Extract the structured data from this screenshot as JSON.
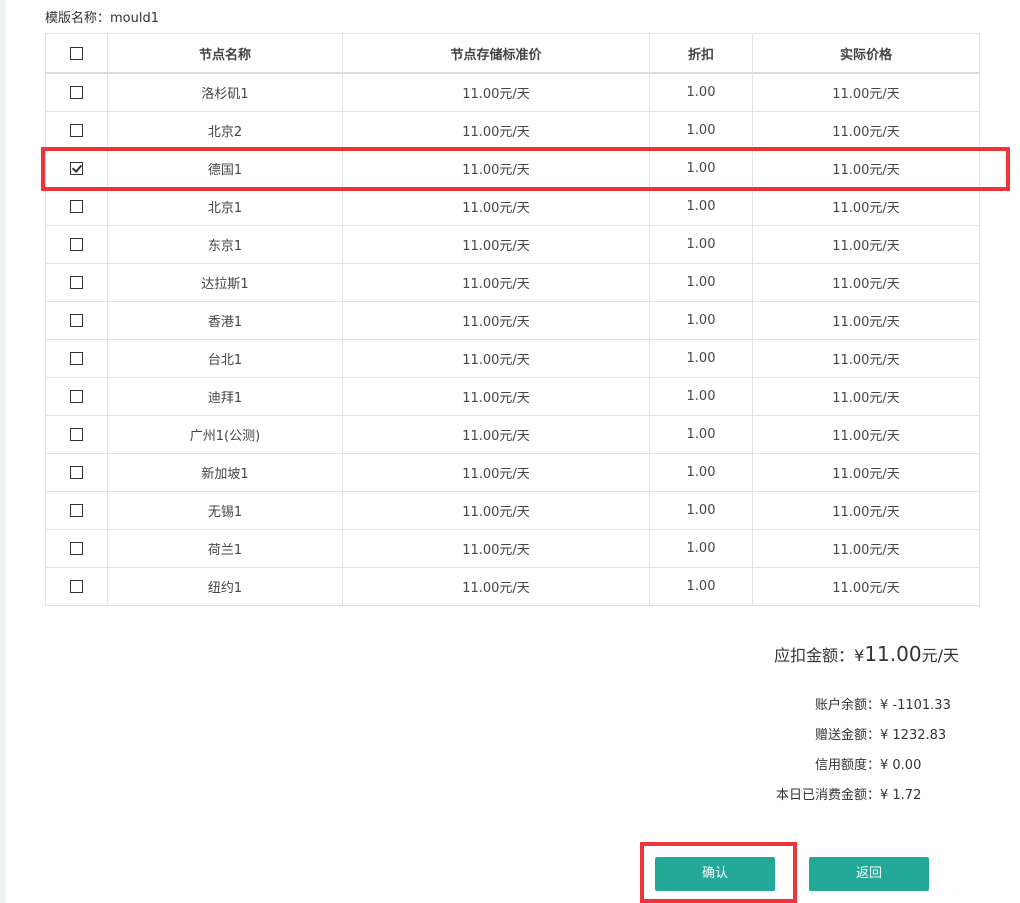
{
  "template": {
    "label": "模版名称：",
    "value": "mould1"
  },
  "table": {
    "headers": [
      "节点名称",
      "节点存储标准价",
      "折扣",
      "实际价格"
    ],
    "rows": [
      {
        "name": "洛杉矶1",
        "standard": "11.00元/天",
        "discount": "1.00",
        "actual": "11.00元/天",
        "checked": false
      },
      {
        "name": "北京2",
        "standard": "11.00元/天",
        "discount": "1.00",
        "actual": "11.00元/天",
        "checked": false
      },
      {
        "name": "德国1",
        "standard": "11.00元/天",
        "discount": "1.00",
        "actual": "11.00元/天",
        "checked": true
      },
      {
        "name": "北京1",
        "standard": "11.00元/天",
        "discount": "1.00",
        "actual": "11.00元/天",
        "checked": false
      },
      {
        "name": "东京1",
        "standard": "11.00元/天",
        "discount": "1.00",
        "actual": "11.00元/天",
        "checked": false
      },
      {
        "name": "达拉斯1",
        "standard": "11.00元/天",
        "discount": "1.00",
        "actual": "11.00元/天",
        "checked": false
      },
      {
        "name": "香港1",
        "standard": "11.00元/天",
        "discount": "1.00",
        "actual": "11.00元/天",
        "checked": false
      },
      {
        "name": "台北1",
        "standard": "11.00元/天",
        "discount": "1.00",
        "actual": "11.00元/天",
        "checked": false
      },
      {
        "name": "迪拜1",
        "standard": "11.00元/天",
        "discount": "1.00",
        "actual": "11.00元/天",
        "checked": false
      },
      {
        "name": "广州1(公测)",
        "standard": "11.00元/天",
        "discount": "1.00",
        "actual": "11.00元/天",
        "checked": false
      },
      {
        "name": "新加坡1",
        "standard": "11.00元/天",
        "discount": "1.00",
        "actual": "11.00元/天",
        "checked": false
      },
      {
        "name": "无锡1",
        "standard": "11.00元/天",
        "discount": "1.00",
        "actual": "11.00元/天",
        "checked": false
      },
      {
        "name": "荷兰1",
        "standard": "11.00元/天",
        "discount": "1.00",
        "actual": "11.00元/天",
        "checked": false
      },
      {
        "name": "纽约1",
        "standard": "11.00元/天",
        "discount": "1.00",
        "actual": "11.00元/天",
        "checked": false
      }
    ]
  },
  "summary": {
    "deduct_label": "应扣金额：",
    "currency": "¥",
    "deduct_amount": "11.00",
    "deduct_unit": "元/天",
    "balance_label": "账户余额：",
    "balance_value": "¥ -1101.33",
    "gift_label": "赠送金额：",
    "gift_value": "¥ 1232.83",
    "credit_label": "信用额度：",
    "credit_value": "¥ 0.00",
    "today_label": "本日已消费金额：",
    "today_value": "¥ 1.72"
  },
  "buttons": {
    "confirm": "确认",
    "back": "返回"
  },
  "colors": {
    "primary_button": "#24a998",
    "highlight": "#ee3438"
  }
}
